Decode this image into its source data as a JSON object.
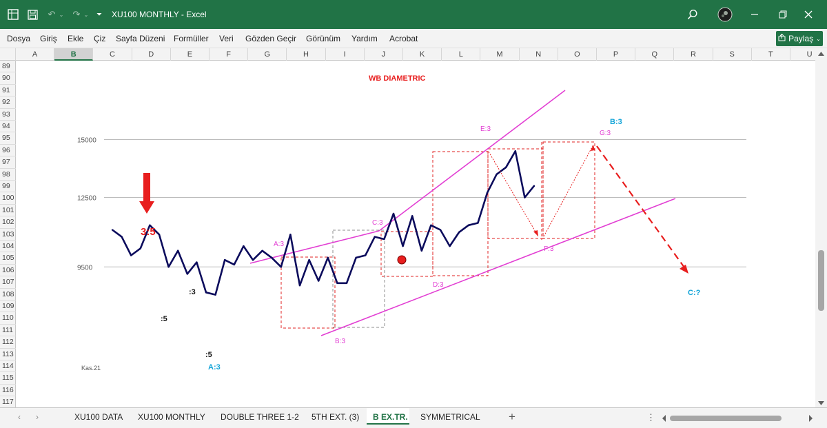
{
  "window": {
    "title": "XU100 MONTHLY  -  Excel",
    "excel_icon": "excel-logo-icon",
    "save_icon": "save-icon",
    "undo_icon": "undo-icon",
    "redo_icon": "redo-icon",
    "search_icon": "search-icon",
    "minimize_icon": "minimize-icon",
    "restore_icon": "restore-icon",
    "close_icon": "close-icon",
    "titlebar_color": "#217346"
  },
  "menu": {
    "items": [
      "Dosya",
      "Giriş",
      "Ekle",
      "Çiz",
      "Sayfa Düzeni",
      "Formüller",
      "Veri",
      "Gözden Geçir",
      "Görünüm",
      "Yardım",
      "Acrobat"
    ],
    "share_label": "Paylaş",
    "share_icon": "share-icon"
  },
  "columns": {
    "labels": [
      "A",
      "B",
      "C",
      "D",
      "E",
      "F",
      "G",
      "H",
      "I",
      "J",
      "K",
      "L",
      "M",
      "N",
      "O",
      "P",
      "Q",
      "R",
      "S",
      "T",
      "U"
    ],
    "selected": "B"
  },
  "rows": {
    "labels": [
      "89",
      "90",
      "91",
      "92",
      "93",
      "94",
      "95",
      "96",
      "97",
      "98",
      "99",
      "100",
      "101",
      "102",
      "103",
      "104",
      "105",
      "106",
      "107",
      "108",
      "109",
      "110",
      "111",
      "112",
      "113",
      "114",
      "115",
      "116",
      "117"
    ]
  },
  "chart_data": {
    "type": "line",
    "title": "WB DIAMETRIC",
    "y_tick_labels": [
      "15000",
      "12500",
      "9500"
    ],
    "y_gridlines": [
      15000,
      12500,
      9500
    ],
    "x_start_label": "Kas.21",
    "series": [
      {
        "values": [
          11100,
          10800,
          10000,
          10300,
          11300,
          10900,
          9500,
          10200,
          9200,
          9700,
          8400,
          8300,
          9800,
          9600,
          10400,
          9800,
          10200,
          9900,
          9500,
          10900,
          8700,
          9800,
          8900,
          9900,
          8800,
          8800,
          9900,
          10000,
          10800,
          10700,
          11800,
          10400,
          11700,
          10200,
          11300,
          11100,
          10400,
          11000,
          11300,
          11400,
          12700,
          13500,
          13800,
          14500,
          12500,
          13000
        ]
      }
    ],
    "annotations": {
      "big_label": "3:5",
      "black_labels": [
        ":3",
        ":5",
        ":5"
      ],
      "blue_labels": [
        "A:3",
        "B:3",
        "C:?"
      ],
      "magenta_labels": [
        "A:3",
        "B:3",
        "C:3",
        "D:3",
        "E:3",
        "F:3",
        "G:3"
      ]
    },
    "colors": {
      "series": "#0b0b5c",
      "trendline": "#e23fd3",
      "boxes": "#e02020",
      "arrow": "#e81e1e",
      "projection": "#e81e1e",
      "blue_label": "#12a4d8",
      "magenta_label": "#e23fd3",
      "marker": "#e81e1e",
      "gridline": "#bcbcbc"
    }
  },
  "tabs": {
    "items": [
      "XU100 DATA",
      "XU100 MONTHLY",
      "DOUBLE THREE 1-2",
      "5TH EXT. (3)",
      "B EX.TR.",
      "SYMMETRICAL"
    ],
    "active": "B EX.TR.",
    "add_label": "+",
    "more_label": "⋮"
  }
}
